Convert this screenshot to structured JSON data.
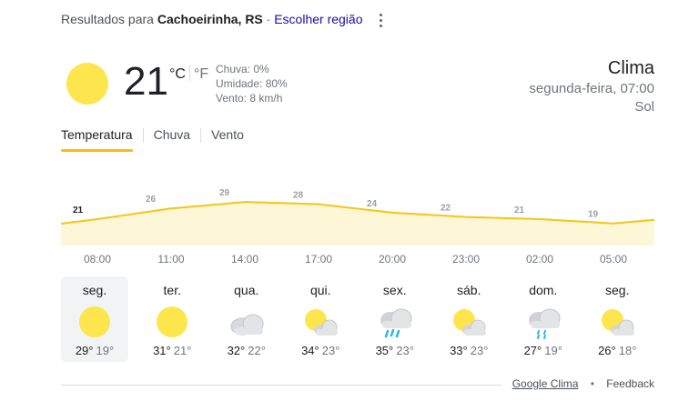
{
  "location_bar": {
    "prefix": "Resultados para",
    "location": "Cachoeirinha, RS",
    "separator": "·",
    "change_region": "Escolher região",
    "menu_icon": "more-vert-icon"
  },
  "current": {
    "icon": "sun-icon",
    "temperature": "21",
    "unit_celsius": "°C",
    "unit_fahrenheit": "°F",
    "rain": "Chuva: 0%",
    "humidity": "Umidade: 80%",
    "wind": "Vento: 8 km/h"
  },
  "header": {
    "title": "Clima",
    "day_time": "segunda-feira, 07:00",
    "condition": "Sol"
  },
  "tabs": [
    {
      "label": "Temperatura",
      "active": true
    },
    {
      "label": "Chuva",
      "active": false
    },
    {
      "label": "Vento",
      "active": false
    }
  ],
  "chart_data": {
    "type": "area",
    "title": "",
    "xlabel": "",
    "ylabel": "",
    "x": [
      "08:00",
      "11:00",
      "14:00",
      "17:00",
      "20:00",
      "23:00",
      "02:00",
      "05:00"
    ],
    "values": [
      21,
      26,
      29,
      28,
      24,
      22,
      21,
      19
    ],
    "data_labels": [
      "21",
      "26",
      "29",
      "28",
      "24",
      "22",
      "21",
      "19"
    ],
    "ylim": [
      10,
      32
    ],
    "colors": {
      "line": "#f5c518",
      "fill": "#fef7d7",
      "label": "#9aa0a6"
    },
    "grid": false
  },
  "days": [
    {
      "name": "seg.",
      "icon": "sunny-icon",
      "max": "29°",
      "min": "19°",
      "selected": true
    },
    {
      "name": "ter.",
      "icon": "sunny-icon",
      "max": "31°",
      "min": "21°",
      "selected": false
    },
    {
      "name": "qua.",
      "icon": "cloudy-icon",
      "max": "32°",
      "min": "22°",
      "selected": false
    },
    {
      "name": "qui.",
      "icon": "partly-cloudy-icon",
      "max": "34°",
      "min": "23°",
      "selected": false
    },
    {
      "name": "sex.",
      "icon": "thunderstorm-icon",
      "max": "35°",
      "min": "23°",
      "selected": false
    },
    {
      "name": "sáb.",
      "icon": "partly-cloudy-icon",
      "max": "33°",
      "min": "23°",
      "selected": false
    },
    {
      "name": "dom.",
      "icon": "rain-showers-icon",
      "max": "27°",
      "min": "19°",
      "selected": false
    },
    {
      "name": "seg.",
      "icon": "partly-cloudy-icon",
      "max": "26°",
      "min": "18°",
      "selected": false
    }
  ],
  "footer": {
    "source_link": "Google Clima",
    "separator": "•",
    "feedback": "Feedback"
  }
}
